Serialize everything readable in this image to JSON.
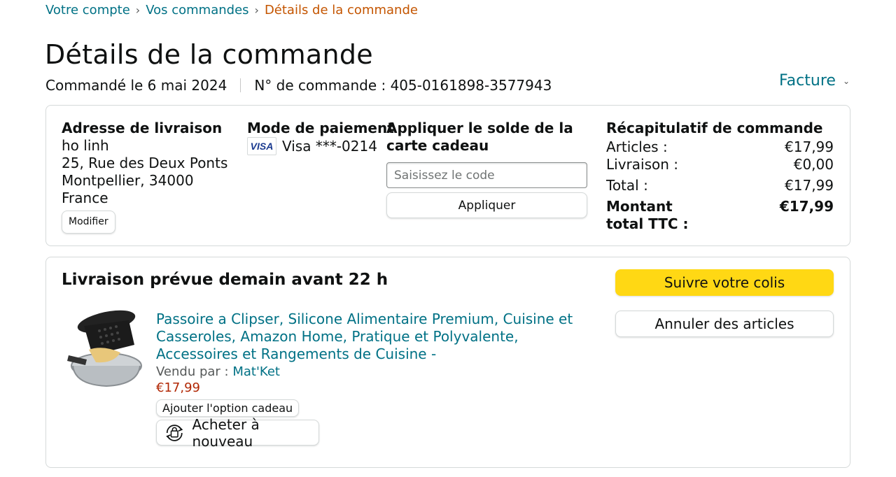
{
  "breadcrumb": {
    "items": [
      "Votre compte",
      "Vos commandes"
    ],
    "current": "Détails de la commande",
    "separator": "›"
  },
  "page_title": "Détails de la commande",
  "order_date": "Commandé le 6 mai 2024",
  "order_number": "N° de commande : 405-0161898-3577943",
  "invoice_label": "Facture",
  "shipping_address": {
    "title": "Adresse de livraison",
    "name": "ho linh",
    "street": "25, Rue des Deux Ponts",
    "city": "Montpellier, 34000",
    "country": "France",
    "edit_label": "Modifier"
  },
  "payment": {
    "title": "Mode de paiement",
    "card_brand": "VISA",
    "card_text": "Visa ***-0214"
  },
  "gift_card": {
    "title": "Appliquer le solde de la carte cadeau",
    "placeholder": "Saisissez le code",
    "apply_label": "Appliquer"
  },
  "recap": {
    "title": "Récapitulatif de commande",
    "rows": [
      {
        "label": "Articles :",
        "value": "€17,99"
      },
      {
        "label": "Livraison :",
        "value": "€0,00"
      },
      {
        "label": "Total :",
        "value": "€17,99"
      },
      {
        "label": "Montant total TTC :",
        "value": "€17,99"
      }
    ]
  },
  "shipment": {
    "title": "Livraison prévue demain avant 22 h",
    "track_label": "Suivre votre colis",
    "cancel_label": "Annuler des articles",
    "product": {
      "title": "Passoire a Clipser, Silicone Alimentaire Premium, Cuisine et Casseroles, Amazon Home, Pratique et Polyvalente, Accessoires et Rangements de Cuisine -",
      "seller_prefix": "Vendu par :",
      "seller": "Mat'Ket",
      "price": "€17,99",
      "gift_label": "Ajouter l'option cadeau",
      "buy_again_label": "Acheter à nouveau"
    }
  },
  "colors": {
    "link": "#007185",
    "breadcrumb_current": "#c45500",
    "price": "#b12704",
    "primary_button": "#ffd814",
    "border": "#d5d9d9"
  }
}
